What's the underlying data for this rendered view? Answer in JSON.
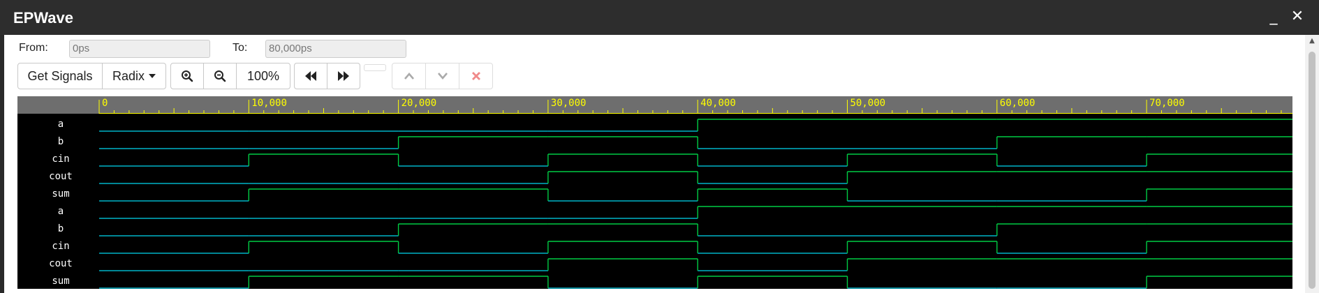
{
  "window": {
    "title": "EPWave",
    "minimize_icon": "minimize-icon",
    "close_icon": "close-icon"
  },
  "range": {
    "from_label": "From:",
    "from_value": "0ps",
    "to_label": "To:",
    "to_value": "80,000ps"
  },
  "toolbar": {
    "get_signals_label": "Get Signals",
    "radix_label": "Radix",
    "zoom_level": "100%",
    "icons": [
      "zoom-in-icon",
      "zoom-out-icon",
      "rewind-icon",
      "fast-forward-icon",
      "move-up-icon",
      "move-down-icon",
      "delete-icon"
    ]
  },
  "timeline": {
    "ticks": [
      {
        "t": 0,
        "label": "0"
      },
      {
        "t": 10000,
        "label": "10,000"
      },
      {
        "t": 20000,
        "label": "20,000"
      },
      {
        "t": 30000,
        "label": "30,000"
      },
      {
        "t": 40000,
        "label": "40,000"
      },
      {
        "t": 50000,
        "label": "50,000"
      },
      {
        "t": 60000,
        "label": "60,000"
      },
      {
        "t": 70000,
        "label": "70,000"
      }
    ],
    "end": 80000
  },
  "signals": [
    {
      "name": "a",
      "values": [
        0,
        0,
        0,
        0,
        1,
        1,
        1,
        1
      ]
    },
    {
      "name": "b",
      "values": [
        0,
        0,
        1,
        1,
        0,
        0,
        1,
        1
      ]
    },
    {
      "name": "cin",
      "values": [
        0,
        1,
        0,
        1,
        0,
        1,
        0,
        1
      ]
    },
    {
      "name": "cout",
      "values": [
        0,
        0,
        0,
        1,
        0,
        1,
        1,
        1
      ]
    },
    {
      "name": "sum",
      "values": [
        0,
        1,
        1,
        0,
        1,
        0,
        0,
        1
      ]
    },
    {
      "name": "a",
      "values": [
        0,
        0,
        0,
        0,
        1,
        1,
        1,
        1
      ]
    },
    {
      "name": "b",
      "values": [
        0,
        0,
        1,
        1,
        0,
        0,
        1,
        1
      ]
    },
    {
      "name": "cin",
      "values": [
        0,
        1,
        0,
        1,
        0,
        1,
        0,
        1
      ]
    },
    {
      "name": "cout",
      "values": [
        0,
        0,
        0,
        1,
        0,
        1,
        1,
        1
      ]
    },
    {
      "name": "sum",
      "values": [
        0,
        1,
        1,
        0,
        1,
        0,
        0,
        1
      ]
    }
  ],
  "colors": {
    "ruler_bg": "#6e6e6e",
    "ruler_fg": "#ffff00",
    "wave_bg": "#000000",
    "high": "#00cc44",
    "low": "#00b4c8",
    "text": "#ffffff"
  }
}
